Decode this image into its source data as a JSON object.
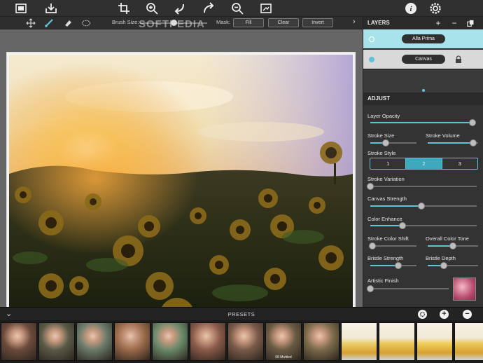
{
  "toolbar2": {
    "brush_size_label": "Brush Size:",
    "brush_size_fraction": 0.5,
    "mask_label": "Mask:",
    "fill_label": "Fill",
    "clear_label": "Clear",
    "invert_label": "Invert"
  },
  "layers": {
    "title": "LAYERS",
    "items": [
      {
        "label": "Alla Prima",
        "selected": true
      },
      {
        "label": "Canvas",
        "selected": false
      }
    ]
  },
  "adjust": {
    "title": "ADJUST",
    "sliders": [
      {
        "label": "Layer Opacity",
        "value": 0.97
      },
      {
        "label": "Stroke Size",
        "value": 0.33
      },
      {
        "label": "Stroke Volume",
        "value": 0.9
      },
      {
        "label": "Stroke Variation",
        "value": 0.0
      },
      {
        "label": "Canvas Strength",
        "value": 0.48
      },
      {
        "label": "Color Enhance",
        "value": 0.3
      },
      {
        "label": "Stroke Color Shift",
        "value": 0.05
      },
      {
        "label": "Overall Color Tone",
        "value": 0.5
      },
      {
        "label": "Bristle Strength",
        "value": 0.6
      },
      {
        "label": "Bristle Depth",
        "value": 0.32
      },
      {
        "label": "Artistic Finish",
        "value": 0.0
      }
    ],
    "stroke_style": {
      "label": "Stroke Style",
      "options": [
        "1",
        "2",
        "3"
      ],
      "selected": "2"
    }
  },
  "presets": {
    "title": "PRESETS",
    "thumbs": [
      {
        "label": "",
        "tone": "#6b4a3c"
      },
      {
        "label": "",
        "tone": "#5a5a48"
      },
      {
        "label": "",
        "tone": "#6a7a6a"
      },
      {
        "label": "",
        "tone": "#9a6a4a"
      },
      {
        "label": "",
        "tone": "#6a8a6a"
      },
      {
        "label": "",
        "tone": "#8a5a4a"
      },
      {
        "label": "",
        "tone": "#7a5a4a"
      },
      {
        "label": "08 Mottled",
        "tone": "#6a5a44"
      },
      {
        "label": "",
        "tone": "#7a6a4a"
      },
      {
        "label": "",
        "tone": "#e9cf6a"
      },
      {
        "label": "",
        "tone": "#e8c85a"
      },
      {
        "label": "",
        "tone": "#efcf5a"
      },
      {
        "label": "",
        "tone": "#e9c85a"
      }
    ]
  },
  "watermark": "SOFTPEDIA",
  "colors": {
    "accent": "#5fc4d6",
    "panel_bg": "#333333",
    "toolbar_bg": "#303030"
  }
}
